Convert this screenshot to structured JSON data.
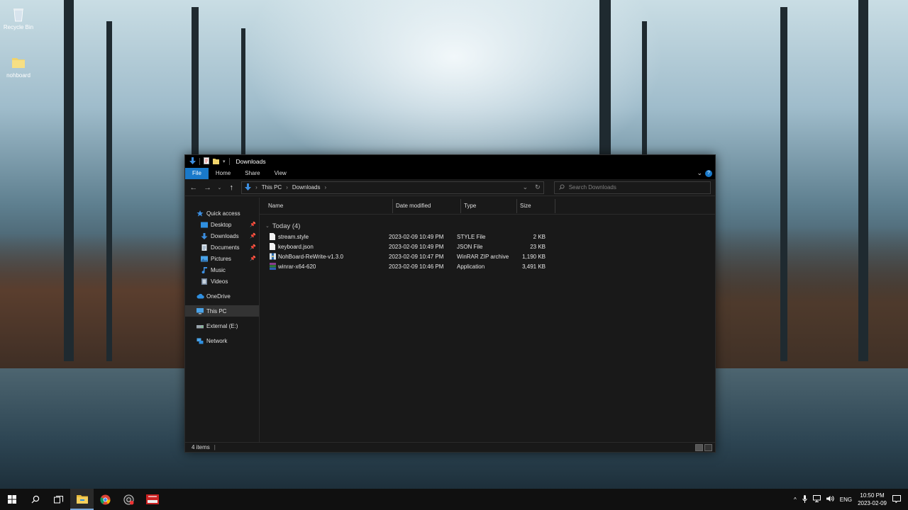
{
  "desktop": {
    "icons": [
      {
        "label": "Recycle Bin"
      },
      {
        "label": "nohboard"
      }
    ]
  },
  "window": {
    "title": "Downloads",
    "ribbon_tabs": [
      "File",
      "Home",
      "Share",
      "View"
    ],
    "address": {
      "crumbs": [
        "This PC",
        "Downloads"
      ]
    },
    "search_placeholder": "Search Downloads",
    "columns": {
      "name": "Name",
      "date": "Date modified",
      "type": "Type",
      "size": "Size"
    },
    "group_label": "Today (4)",
    "files": [
      {
        "name": "stream.style",
        "date": "2023-02-09 10:49 PM",
        "type": "STYLE File",
        "size": "2 KB",
        "icon": "file-icon"
      },
      {
        "name": "keyboard.json",
        "date": "2023-02-09 10:49 PM",
        "type": "JSON File",
        "size": "23 KB",
        "icon": "file-icon"
      },
      {
        "name": "NohBoard-ReWrite-v1.3.0",
        "date": "2023-02-09 10:47 PM",
        "type": "WinRAR ZIP archive",
        "size": "1,190 KB",
        "icon": "zip-archive-icon"
      },
      {
        "name": "winrar-x64-620",
        "date": "2023-02-09 10:46 PM",
        "type": "Application",
        "size": "3,491 KB",
        "icon": "winrar-installer-icon"
      }
    ],
    "sidebar": {
      "quick_access": "Quick access",
      "quick_items": [
        "Desktop",
        "Downloads",
        "Documents",
        "Pictures",
        "Music",
        "Videos"
      ],
      "onedrive": "OneDrive",
      "this_pc": "This PC",
      "external": "External (E:)",
      "network": "Network"
    },
    "status": "4 items"
  },
  "taskbar": {
    "tray_lang": "ENG",
    "time": "10:50 PM",
    "date": "2023-02-09"
  },
  "colors": {
    "accent": "#1979ca",
    "window_bg": "#191919",
    "taskbar_bg": "#101010"
  }
}
